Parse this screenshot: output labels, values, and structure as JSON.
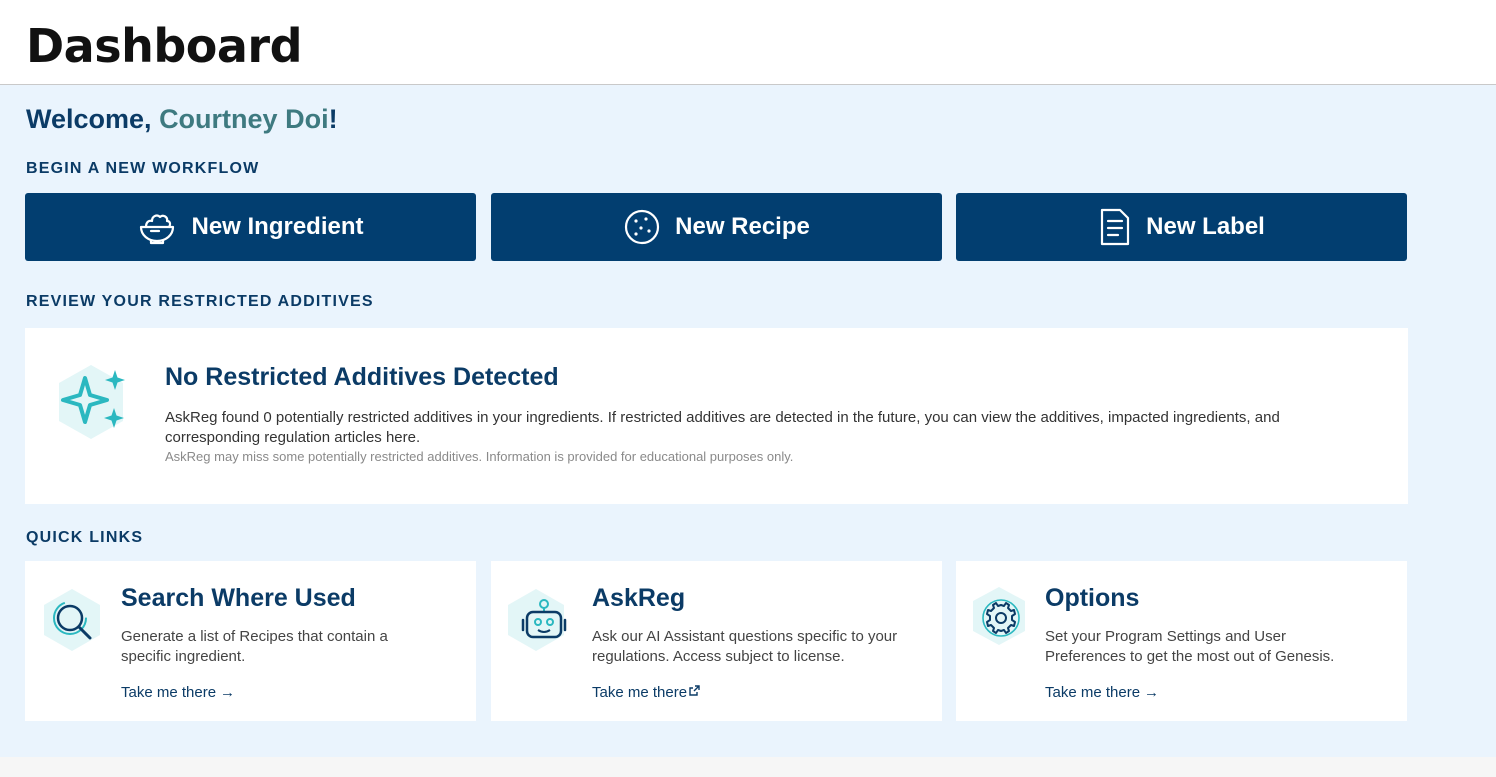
{
  "header": {
    "title": "Dashboard"
  },
  "welcome": {
    "prefix": "Welcome, ",
    "name": "Courtney Doi",
    "suffix": "!"
  },
  "sections": {
    "workflow": "BEGIN A NEW WORKFLOW",
    "additives": "REVIEW YOUR RESTRICTED ADDITIVES",
    "quick_links": "QUICK LINKS"
  },
  "workflow_buttons": [
    {
      "label": "New Ingredient",
      "icon": "bowl-icon"
    },
    {
      "label": "New Recipe",
      "icon": "cookie-icon"
    },
    {
      "label": "New Label",
      "icon": "document-icon"
    }
  ],
  "additives": {
    "icon": "sparkle-icon",
    "title": "No Restricted Additives Detected",
    "description": "AskReg found 0 potentially restricted additives in your ingredients. If restricted additives are detected in the future, you can view the additives, impacted ingredients, and corresponding regulation articles here.",
    "note": "AskReg may miss some potentially restricted additives. Information is provided for educational purposes only."
  },
  "quick_links": [
    {
      "title": "Search Where Used",
      "description": "Generate a list of Recipes that contain a specific ingredient.",
      "link": "Take me there",
      "icon": "search-icon",
      "link_icon": "arrow-right-icon"
    },
    {
      "title": "AskReg",
      "description": "Ask our AI Assistant questions specific to your regulations. Access subject to license.",
      "link": "Take me there",
      "icon": "robot-icon",
      "link_icon": "external-link-icon"
    },
    {
      "title": "Options",
      "description": "Set your Program Settings and User Preferences to get the most out of Genesis.",
      "link": "Take me there",
      "icon": "gear-icon",
      "link_icon": "arrow-right-icon"
    }
  ],
  "colors": {
    "primary": "#023e70",
    "heading": "#0b3b66",
    "accent_name": "#3e7a80",
    "teal_icon": "#2bb8c0",
    "background": "#eaf4fd"
  }
}
